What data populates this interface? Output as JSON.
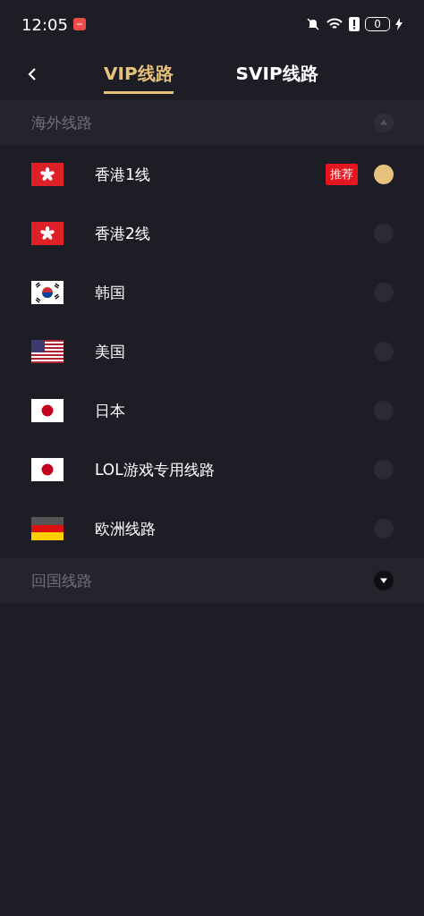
{
  "status_bar": {
    "time": "12:05",
    "battery": "0"
  },
  "tabs": [
    {
      "label": "VIP线路",
      "selected": true
    },
    {
      "label": "SVIP线路",
      "selected": false
    }
  ],
  "sections": [
    {
      "title": "海外线路",
      "expanded": true,
      "lines": [
        {
          "kind": "hk",
          "name": "香港1线",
          "badge": "推荐",
          "selected": true
        },
        {
          "kind": "hk",
          "name": "香港2线",
          "selected": false
        },
        {
          "kind": "kr",
          "name": "韩国",
          "selected": false
        },
        {
          "kind": "us",
          "name": "美国",
          "selected": false
        },
        {
          "kind": "jp",
          "name": "日本",
          "selected": false
        },
        {
          "kind": "jp",
          "name": "LOL游戏专用线路",
          "selected": false
        },
        {
          "kind": "de",
          "name": "欧洲线路",
          "selected": false
        }
      ]
    },
    {
      "title": "回国线路",
      "expanded": false
    }
  ]
}
